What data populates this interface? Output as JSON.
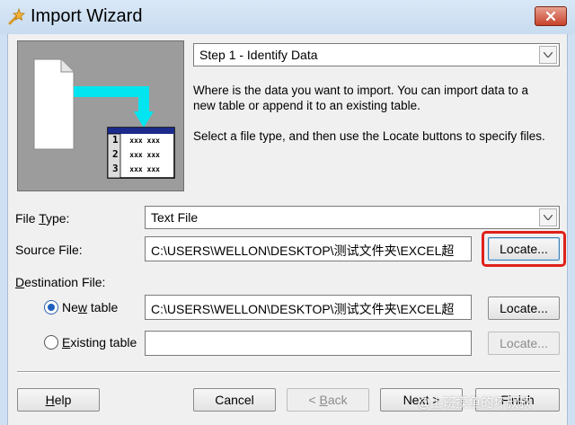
{
  "window": {
    "title": "Import Wizard",
    "close_label": "×"
  },
  "step_select": {
    "value": "Step 1 - Identify Data"
  },
  "description": {
    "paragraph1": "Where is the data you want to import. You can import data to a new table or append it to an existing table.",
    "paragraph2": "Select a file type, and then use the Locate buttons to specify files."
  },
  "illustration": {
    "rows": [
      {
        "num": "1",
        "cells": "xxx xxx"
      },
      {
        "num": "2",
        "cells": "xxx xxx"
      },
      {
        "num": "3",
        "cells": "xxx xxx"
      }
    ]
  },
  "file_type": {
    "label_pre": "File ",
    "label_key": "T",
    "label_post": "ype:",
    "value": "Text File"
  },
  "source_file": {
    "label": "Source File:",
    "value": "C:\\USERS\\WELLON\\DESKTOP\\测试文件夹\\EXCEL超",
    "locate_label": "Locate..."
  },
  "destination": {
    "label_key": "D",
    "label_post": "estination File:",
    "new_table": {
      "label_pre": "Ne",
      "label_key": "w",
      "label_post": " table",
      "checked": true,
      "value": "C:\\USERS\\WELLON\\DESKTOP\\测试文件夹\\EXCEL超",
      "locate_label": "Locate..."
    },
    "existing_table": {
      "label_key": "E",
      "label_post": "xisting table",
      "checked": false,
      "value": "",
      "locate_label": "Locate..."
    }
  },
  "footer": {
    "help_key": "H",
    "help_post": "elp",
    "cancel": "Cancel",
    "back_arrow": "< ",
    "back_key": "B",
    "back_post": "ack",
    "next_pre": "Nex",
    "next_post": "t >",
    "finish": "Finish"
  },
  "watermark": "@上班摸鱼的坏叔叔",
  "colors": {
    "accent": "#1d5fbf",
    "highlight": "#e0201a",
    "arrow": "#00e5f0"
  }
}
